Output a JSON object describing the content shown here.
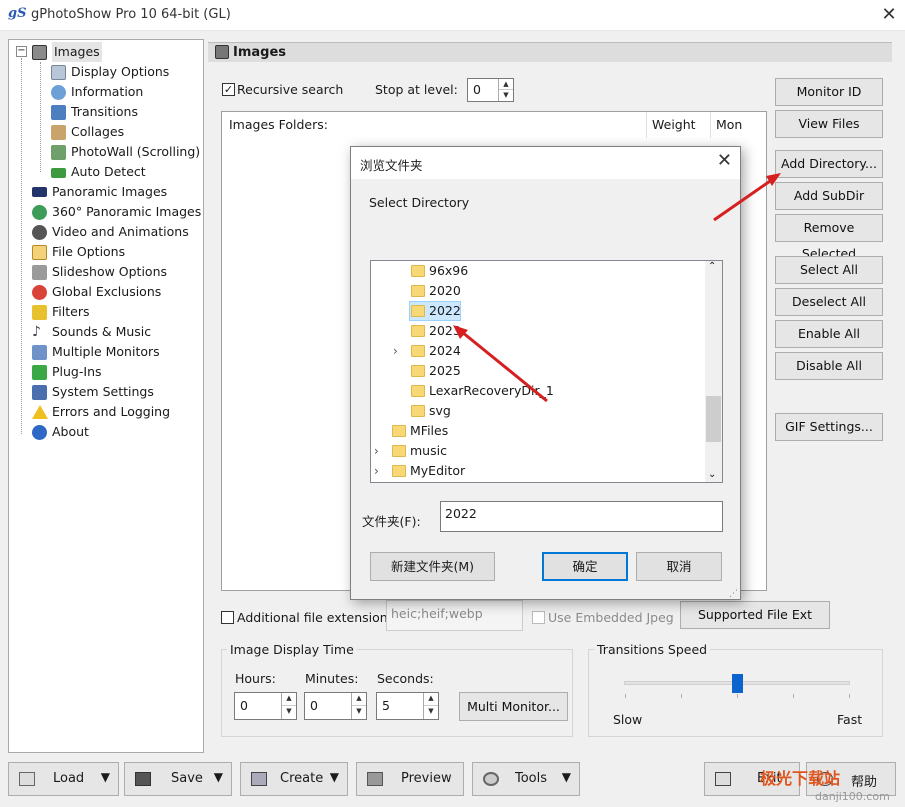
{
  "window": {
    "logo": "gS",
    "title": "gPhotoShow Pro 10 64-bit (GL)"
  },
  "tree": {
    "items": [
      {
        "label": "Images",
        "icon": "camera-icon"
      },
      {
        "label": "Display Options",
        "icon": "display-icon"
      },
      {
        "label": "Information",
        "icon": "info-icon"
      },
      {
        "label": "Transitions",
        "icon": "transitions-icon"
      },
      {
        "label": "Collages",
        "icon": "collage-icon"
      },
      {
        "label": "PhotoWall (Scrolling)",
        "icon": "photowall-icon"
      },
      {
        "label": "Auto Detect",
        "icon": "autodetect-icon"
      },
      {
        "label": "Panoramic Images",
        "icon": "panoramic-icon"
      },
      {
        "label": "360° Panoramic Images",
        "icon": "globe-icon"
      },
      {
        "label": "Video and Animations",
        "icon": "video-icon"
      },
      {
        "label": "File Options",
        "icon": "file-icon"
      },
      {
        "label": "Slideshow Options",
        "icon": "tools-icon"
      },
      {
        "label": "Global Exclusions",
        "icon": "block-icon"
      },
      {
        "label": "Filters",
        "icon": "filter-icon"
      },
      {
        "label": "Sounds & Music",
        "icon": "music-icon"
      },
      {
        "label": "Multiple Monitors",
        "icon": "monitors-icon"
      },
      {
        "label": "Plug-Ins",
        "icon": "plugin-icon"
      },
      {
        "label": "System Settings",
        "icon": "system-icon"
      },
      {
        "label": "Errors and Logging",
        "icon": "warning-icon"
      },
      {
        "label": "About",
        "icon": "about-icon"
      }
    ]
  },
  "section": {
    "title": "Images"
  },
  "search": {
    "recursive_label": "Recursive search",
    "recursive_checked": true,
    "stop_label": "Stop at level:",
    "stop_value": "0"
  },
  "list": {
    "col_folders": "Images Folders:",
    "col_weight": "Weight",
    "col_mon": "Mon"
  },
  "right_buttons": {
    "monitor_id": "Monitor ID",
    "view_files": "View Files",
    "add_directory": "Add Directory...",
    "add_subdir": "Add SubDir",
    "remove_selected": "Remove Selected",
    "select_all": "Select All",
    "deselect_all": "Deselect All",
    "enable_all": "Enable All",
    "disable_all": "Disable All",
    "gif_settings": "GIF Settings..."
  },
  "extensions": {
    "additional_label": "Additional file extensions:",
    "additional_value": "heic;heif;webp",
    "embedded_label": "Use Embedded Jpeg",
    "supported_button": "Supported File Ext"
  },
  "display_time": {
    "title": "Image Display Time",
    "hours_label": "Hours:",
    "hours": "0",
    "minutes_label": "Minutes:",
    "minutes": "0",
    "seconds_label": "Seconds:",
    "seconds": "5",
    "multi_monitor": "Multi Monitor..."
  },
  "transitions_speed": {
    "title": "Transitions Speed",
    "slow": "Slow",
    "fast": "Fast",
    "level": 0.5
  },
  "toolbar": {
    "load": "Load",
    "save": "Save",
    "create": "Create",
    "preview": "Preview",
    "tools": "Tools",
    "exit": "Exit",
    "help": "帮助"
  },
  "dialog": {
    "title": "浏览文件夹",
    "prompt": "Select Directory",
    "folders": [
      {
        "name": "96x96",
        "expandable": false
      },
      {
        "name": "2020",
        "expandable": false
      },
      {
        "name": "2022",
        "expandable": false,
        "selected": true
      },
      {
        "name": "2023",
        "expandable": false
      },
      {
        "name": "2024",
        "expandable": true
      },
      {
        "name": "2025",
        "expandable": false
      },
      {
        "name": "LexarRecoveryDir_1",
        "expandable": false
      },
      {
        "name": "svg",
        "expandable": false
      },
      {
        "name": "MFiles",
        "expandable": false
      },
      {
        "name": "music",
        "expandable": true
      },
      {
        "name": "MyEditor",
        "expandable": true
      }
    ],
    "folder_label": "文件夹(F):",
    "folder_value": "2022",
    "new_folder": "新建文件夹(M)",
    "ok": "确定",
    "cancel": "取消"
  },
  "watermark": {
    "text": "极光下载站",
    "url": "danji100.com"
  },
  "colors": {
    "accent": "#0b63ce",
    "arrow": "#d62020",
    "selection": "#cce8ff"
  }
}
